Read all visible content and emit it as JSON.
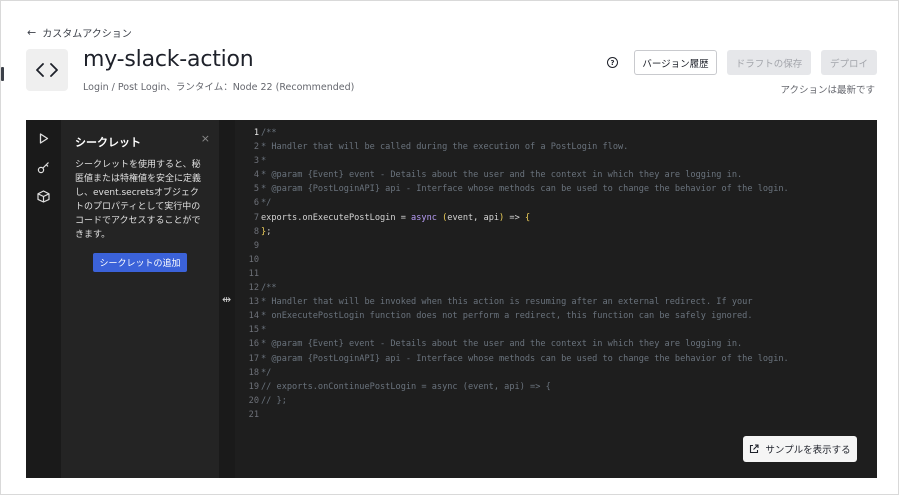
{
  "nav": {
    "back_label": "カスタムアクション"
  },
  "header": {
    "title": "my-slack-action",
    "subtitle": "Login / Post Login、ランタイム：Node 22 (Recommended)",
    "help_glyph": "?",
    "buttons": {
      "history": "バージョン履歴",
      "save_draft": "ドラフトの保存",
      "deploy": "デプロイ"
    },
    "status": "アクションは最新です"
  },
  "sidebar": {
    "icons": [
      "play-icon",
      "key-icon",
      "package-icon"
    ]
  },
  "secrets_panel": {
    "title": "シークレット",
    "close": "×",
    "description": "シークレットを使用すると、秘匿値または特権値を安全に定義し、event.secretsオブジェクトのプロパティとして実行中のコードでアクセスすることができます。",
    "add_button": "シークレットの追加"
  },
  "editor": {
    "active_line": 1,
    "lines": [
      [
        {
          "t": "/**",
          "c": "cm"
        }
      ],
      [
        {
          "t": "* Handler that will be called during the execution of a PostLogin flow.",
          "c": "cm"
        }
      ],
      [
        {
          "t": "*",
          "c": "cm"
        }
      ],
      [
        {
          "t": "* @param {Event} event - Details about the user and the context in which they are logging in.",
          "c": "cm"
        }
      ],
      [
        {
          "t": "* @param {PostLoginAPI} api - Interface whose methods can be used to change the behavior of the login.",
          "c": "cm"
        }
      ],
      [
        {
          "t": "*/",
          "c": "cm"
        }
      ],
      [
        {
          "t": "exports.onExecutePostLogin = ",
          "c": ""
        },
        {
          "t": "async",
          "c": "kw"
        },
        {
          "t": " ",
          "c": ""
        },
        {
          "t": "(",
          "c": "br"
        },
        {
          "t": "event, api",
          "c": ""
        },
        {
          "t": ")",
          "c": "br"
        },
        {
          "t": " => ",
          "c": ""
        },
        {
          "t": "{",
          "c": "br"
        }
      ],
      [
        {
          "t": "}",
          "c": "br"
        },
        {
          "t": ";",
          "c": ""
        }
      ],
      [],
      [],
      [],
      [
        {
          "t": "/**",
          "c": "cm"
        }
      ],
      [
        {
          "t": "* Handler that will be invoked when this action is resuming after an external redirect. If your",
          "c": "cm"
        }
      ],
      [
        {
          "t": "* onExecutePostLogin function does not perform a redirect, this function can be safely ignored.",
          "c": "cm"
        }
      ],
      [
        {
          "t": "*",
          "c": "cm"
        }
      ],
      [
        {
          "t": "* @param {Event} event - Details about the user and the context in which they are logging in.",
          "c": "cm"
        }
      ],
      [
        {
          "t": "* @param {PostLoginAPI} api - Interface whose methods can be used to change the behavior of the login.",
          "c": "cm"
        }
      ],
      [
        {
          "t": "*/",
          "c": "cm"
        }
      ],
      [
        {
          "t": "// exports.onContinuePostLogin = async (event, api) => {",
          "c": "cm"
        }
      ],
      [
        {
          "t": "// };",
          "c": "cm"
        }
      ],
      []
    ],
    "sample_button": "サンプルを表示する"
  },
  "colors": {
    "accent": "#3b62d9",
    "editor_bg": "#1e1e1e",
    "keyword": "#b89df7",
    "bracket": "#f0d15a",
    "comment": "#6a737d"
  }
}
